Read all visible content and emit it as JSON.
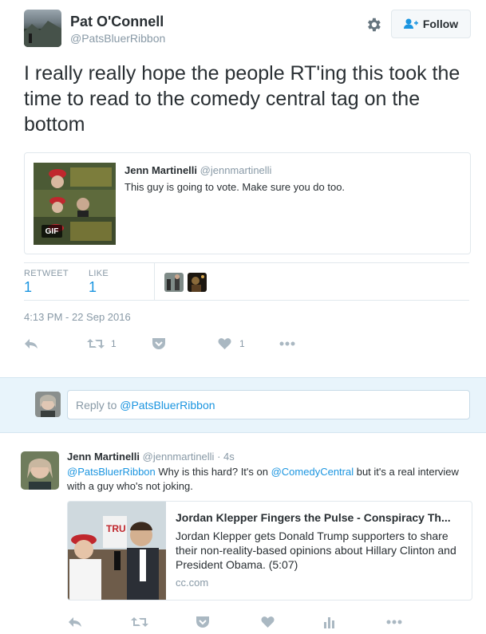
{
  "tweet": {
    "author_name": "Pat O'Connell",
    "author_handle": "@PatsBluerRibbon",
    "follow_label": "Follow",
    "text": "I really really hope the people RT'ing this took the time to read to the comedy central tag on the bottom",
    "quoted": {
      "author_name": "Jenn Martinelli",
      "author_handle": "@jennmartinelli",
      "text": "This guy is going to vote. Make sure you do too.",
      "thumb_badge": "GIF"
    },
    "stats": {
      "retweet_label": "RETWEET",
      "retweet_count": "1",
      "like_label": "LIKE",
      "like_count": "1"
    },
    "timestamp": "4:13 PM - 22 Sep 2016",
    "actions": {
      "retweet_count": "1",
      "like_count": "1"
    }
  },
  "reply_box": {
    "prefix": "Reply to ",
    "mention": "@PatsBluerRibbon"
  },
  "reply": {
    "author_name": "Jenn Martinelli",
    "author_handle": "@jennmartinelli",
    "time": "· 4s",
    "mention1": "@PatsBluerRibbon",
    "text_a": " Why is this hard? It's on ",
    "mention2": "@ComedyCentral",
    "text_b": " but it's a real interview with a guy who's not joking.",
    "card": {
      "title": "Jordan Klepper Fingers the Pulse - Conspiracy Th...",
      "description": "Jordan Klepper gets Donald Trump supporters to share their non-reality-based opinions about Hillary Clinton and President Obama. (5:07)",
      "domain": "cc.com"
    }
  },
  "colors": {
    "accent": "#1b95e0",
    "muted": "#8899a6",
    "text": "#292f33",
    "border": "#e1e8ed"
  }
}
